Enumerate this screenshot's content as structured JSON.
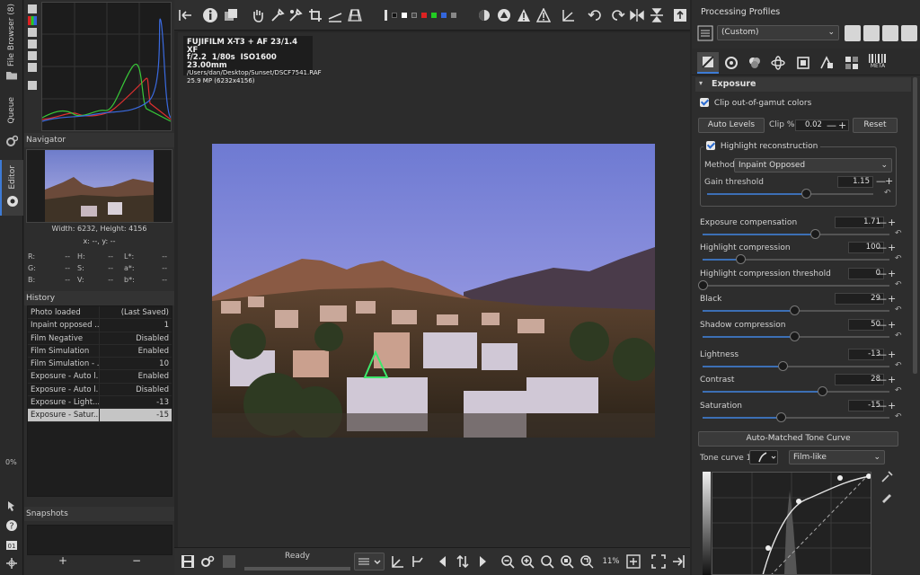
{
  "vertical_tabs": {
    "file_browser": "File Browser (8)",
    "queue": "Queue",
    "editor": "Editor"
  },
  "left": {
    "navigator_title": "Navigator",
    "image_size": "Width: 6232, Height: 4156",
    "cursor_xy": "x: --, y: --",
    "readouts": [
      [
        "R:",
        "--",
        "H:",
        "--",
        "L*:",
        "--"
      ],
      [
        "G:",
        "--",
        "S:",
        "--",
        "a*:",
        "--"
      ],
      [
        "B:",
        "--",
        "V:",
        "--",
        "b*:",
        "--"
      ]
    ],
    "history_title": "History",
    "history": [
      {
        "action": "Photo loaded",
        "value": "(Last Saved)"
      },
      {
        "action": "Inpaint opposed ...",
        "value": "1"
      },
      {
        "action": "Film Negative",
        "value": "Disabled"
      },
      {
        "action": "Film Simulation",
        "value": "Enabled"
      },
      {
        "action": "Film Simulation - ...",
        "value": "10"
      },
      {
        "action": "Exposure - Auto l...",
        "value": "Enabled"
      },
      {
        "action": "Exposure - Auto l...",
        "value": "Disabled"
      },
      {
        "action": "Exposure - Light...",
        "value": "-13"
      },
      {
        "action": "Exposure - Satur...",
        "value": "-15",
        "selected": true
      }
    ],
    "snapshots_title": "Snapshots",
    "add": "+",
    "remove": "−",
    "progress": "0%"
  },
  "info": {
    "line1": "FUJIFILM X-T3 + AF 23/1.4 XF",
    "aperture": "f/2.2",
    "shutter": "1/80s",
    "iso": "ISO1600",
    "focal": "23.00mm",
    "path": "/Users/dan/Desktop/Sunset/DSCF7541.RAF",
    "mp": "25.9 MP (6232x4156)"
  },
  "bottom": {
    "status": "Ready",
    "zoom": "11%"
  },
  "right": {
    "profiles_title": "Processing Profiles",
    "profile": "(Custom)",
    "section": "Exposure",
    "clip_gamut": "Clip out-of-gamut colors",
    "auto_levels": "Auto Levels",
    "clip_label": "Clip %",
    "clip_value": "0.02",
    "reset": "Reset",
    "highlight_recon": "Highlight reconstruction",
    "method_label": "Method:",
    "method_value": "Inpaint Opposed",
    "gain_label": "Gain threshold",
    "gain_value": "1.15",
    "sliders": [
      {
        "label": "Exposure compensation",
        "value": "1.71",
        "pos": 0.6
      },
      {
        "label": "Highlight compression",
        "value": "100",
        "pos": 0.2
      },
      {
        "label": "Highlight compression threshold",
        "value": "0",
        "pos": 0.0
      },
      {
        "label": "Black",
        "value": "29",
        "pos": 0.49
      },
      {
        "label": "Shadow compression",
        "value": "50",
        "pos": 0.49
      },
      {
        "label": "Lightness",
        "value": "-13",
        "pos": 0.43
      },
      {
        "label": "Contrast",
        "value": "28",
        "pos": 0.64
      },
      {
        "label": "Saturation",
        "value": "-15",
        "pos": 0.42
      }
    ],
    "amt_button": "Auto-Matched Tone Curve",
    "tone_curve_label": "Tone curve 1:",
    "tone_curve_type": "Film-like",
    "meta_tab": "META"
  },
  "colors": {
    "accent": "#3d7bd6",
    "panel": "#2d2d2d"
  }
}
